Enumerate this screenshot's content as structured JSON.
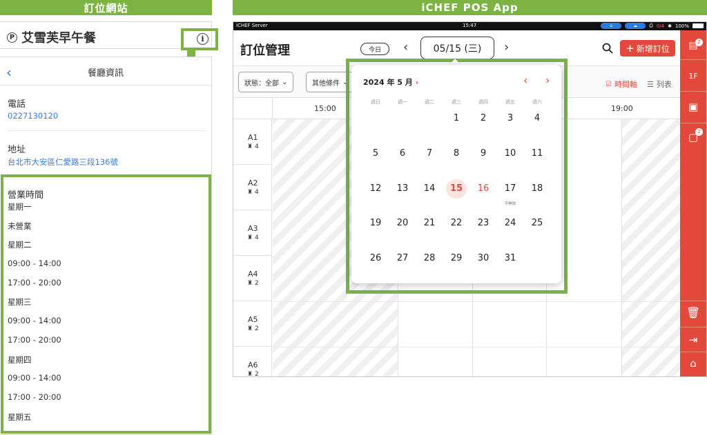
{
  "left_header": "訂位網站",
  "right_header": "iCHEF POS App",
  "site": {
    "restaurant_name": "艾雪芙早午餐",
    "p_icon": "P",
    "info_icon": "i",
    "panel_title": "餐廳資訊",
    "phone_label": "電話",
    "phone_value": "0227130120",
    "address_label": "地址",
    "address_value": "台北市大安區仁愛路三段136號",
    "hours_label": "營業時間",
    "hours": [
      "星期一",
      "未營業",
      "星期二",
      "09:00 - 14:00",
      "17:00 - 20:00",
      "星期三",
      "09:00 - 14:00",
      "17:00 - 20:00",
      "星期四",
      "09:00 - 14:00",
      "17:00 - 20:00",
      "星期五"
    ]
  },
  "pos": {
    "status": {
      "carrier": "iCHEF Server",
      "time": "15:47",
      "printer": "0/4",
      "battery": "100%"
    },
    "title": "訂位管理",
    "today_btn": "今日",
    "prev": "‹",
    "next": "›",
    "date": "05/15 (三)",
    "add_btn": "新增訂位",
    "add_plus": "+",
    "filters": {
      "status": "狀態：全部",
      "other": "其他條件"
    },
    "views": {
      "timeline": "時間軸",
      "list": "列表"
    },
    "times": [
      "15:00",
      "19:00"
    ],
    "tables": [
      {
        "name": "A1",
        "seats": "4"
      },
      {
        "name": "A2",
        "seats": "4"
      },
      {
        "name": "A3",
        "seats": "4"
      },
      {
        "name": "A4",
        "seats": "2"
      },
      {
        "name": "A5",
        "seats": "2"
      },
      {
        "name": "A6",
        "seats": "2"
      }
    ],
    "sidebar": {
      "badge1": "2",
      "floor": "1F",
      "badge2": "2"
    },
    "calendar": {
      "month": "2024 年 5 月",
      "month_chevron": "›",
      "prev": "‹",
      "next": "›",
      "weekdays": [
        "週日",
        "週一",
        "週二",
        "週三",
        "週四",
        "週五",
        "週六"
      ],
      "weeks": [
        [
          "",
          "",
          "",
          "1",
          "2",
          "3",
          "4"
        ],
        [
          "5",
          "6",
          "7",
          "8",
          "9",
          "10",
          "11"
        ],
        [
          "12",
          "13",
          "14",
          "15",
          "16",
          "17",
          "18"
        ],
        [
          "19",
          "20",
          "21",
          "22",
          "23",
          "24",
          "25"
        ],
        [
          "26",
          "27",
          "28",
          "29",
          "30",
          "31",
          ""
        ]
      ],
      "selected": "15",
      "highlight": "16",
      "note_day": "17",
      "note": "不開放"
    }
  },
  "colors": {
    "accent_green": "#7cb342",
    "pos_red": "#e2493a",
    "link_blue": "#3a7bd5"
  }
}
